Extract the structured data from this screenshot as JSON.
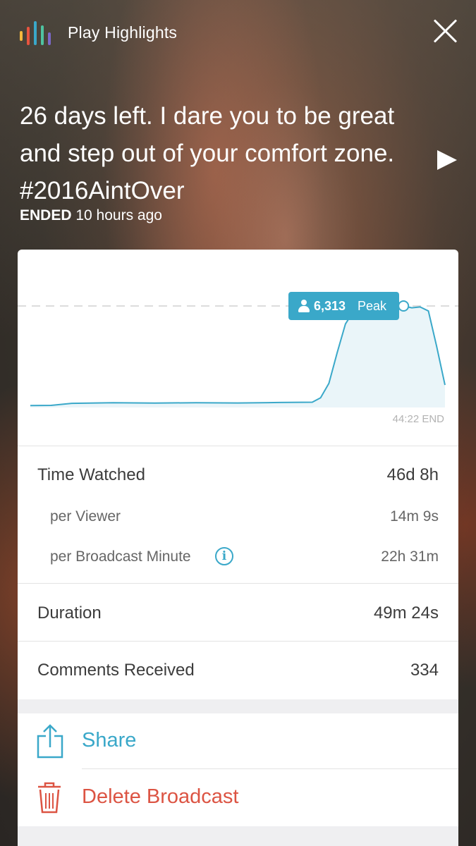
{
  "header": {
    "highlights_label": "Play Highlights",
    "logo_colors": [
      "#f5b83d",
      "#e8543f",
      "#3aa8c9",
      "#4fc3a1",
      "#7b68c8"
    ]
  },
  "broadcast": {
    "title": "26 days left. I dare you to be great and step out of your comfort zone. #2016AintOver",
    "status": "ENDED",
    "time_ago": "10 hours ago"
  },
  "chart_data": {
    "type": "area",
    "peak_value": "6,313",
    "peak_label": "Peak",
    "end_label": "44:22 END",
    "accent_color": "#3aa8c9",
    "x": [
      0,
      0.05,
      0.1,
      0.2,
      0.3,
      0.4,
      0.5,
      0.6,
      0.68,
      0.7,
      0.72,
      0.74,
      0.76,
      0.78,
      0.8,
      0.82,
      0.84,
      0.86,
      0.88,
      0.9,
      0.92,
      0.94,
      0.96,
      0.98,
      1.0
    ],
    "values": [
      120,
      130,
      260,
      300,
      270,
      300,
      280,
      310,
      330,
      600,
      1500,
      3400,
      5200,
      6000,
      5800,
      6050,
      5900,
      6100,
      5950,
      6313,
      6200,
      6250,
      6000,
      3800,
      1400
    ]
  },
  "stats": {
    "time_watched": {
      "label": "Time Watched",
      "value": "46d 8h"
    },
    "per_viewer": {
      "label": "per Viewer",
      "value": "14m 9s"
    },
    "per_broadcast_minute": {
      "label": "per Broadcast Minute",
      "value": "22h 31m"
    },
    "duration": {
      "label": "Duration",
      "value": "49m 24s"
    },
    "comments": {
      "label": "Comments Received",
      "value": "334"
    }
  },
  "actions": {
    "share": "Share",
    "delete": "Delete Broadcast"
  },
  "colors": {
    "accent": "#3aa8c9",
    "danger": "#dc5443"
  }
}
